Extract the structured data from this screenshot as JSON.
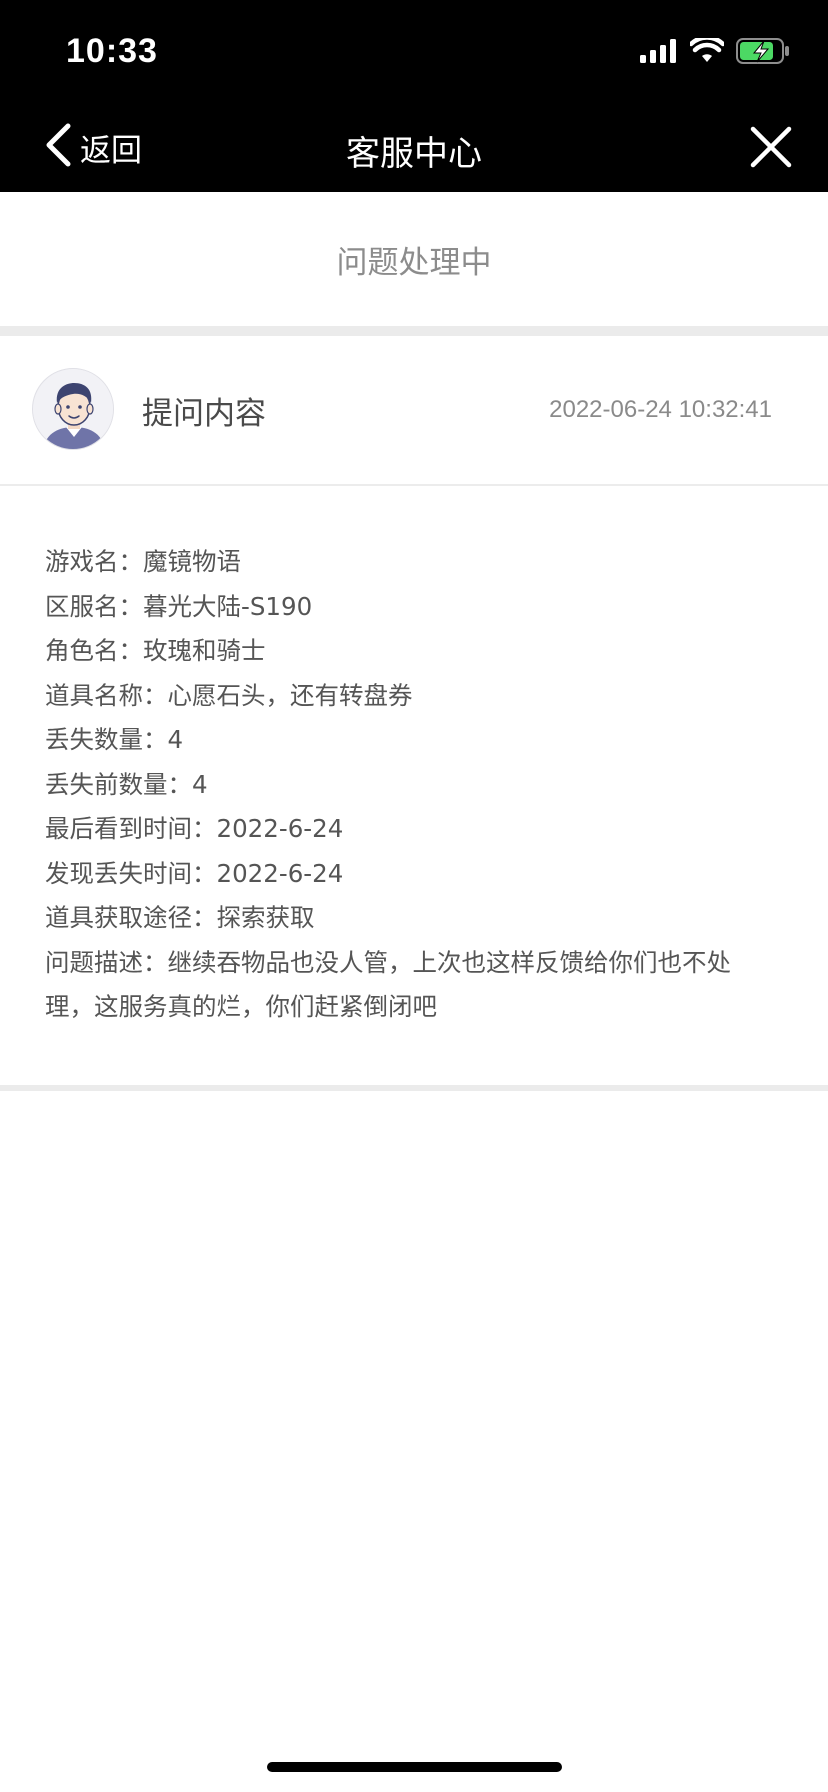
{
  "status_bar": {
    "time": "10:33",
    "icons": [
      "signal-icon",
      "wifi-icon",
      "battery-charging-icon"
    ]
  },
  "nav": {
    "back_label": "返回",
    "title": "客服中心",
    "close_icon": "close-icon"
  },
  "ticket": {
    "status": "问题处理中",
    "header_title": "提问内容",
    "timestamp": "2022-06-24 10:32:41",
    "details": [
      {
        "label": "游戏名：",
        "value": "魔镜物语"
      },
      {
        "label": "区服名：",
        "value": "暮光大陆-S190"
      },
      {
        "label": "角色名：",
        "value": "玫瑰和骑士"
      },
      {
        "label": "道具名称：",
        "value": "心愿石头，还有转盘券"
      },
      {
        "label": "丢失数量：",
        "value": "4"
      },
      {
        "label": "丢失前数量：",
        "value": "4"
      },
      {
        "label": "最后看到时间：",
        "value": "2022-6-24"
      },
      {
        "label": "发现丢失时间：",
        "value": "2022-6-24"
      },
      {
        "label": "道具获取途径：",
        "value": "探索获取"
      },
      {
        "label": "问题描述：",
        "value": "继续吞物品也没人管，上次也这样反馈给你们也不处理，这服务真的烂，你们赶紧倒闭吧"
      }
    ]
  },
  "colors": {
    "top_bar": "#000000",
    "status_text": "#8c8c8c",
    "divider": "#ebebeb",
    "battery_green": "#4cd964",
    "avatar_navy": "#3d4470"
  }
}
